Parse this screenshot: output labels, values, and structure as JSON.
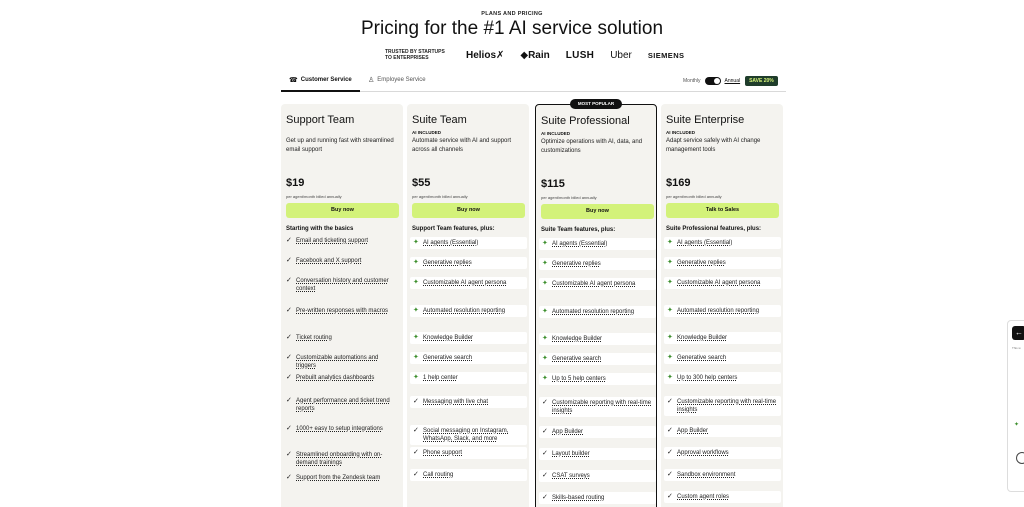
{
  "header": {
    "eyebrow": "PLANS AND PRICING",
    "title": "Pricing for the #1 AI service solution",
    "trusted_line1": "TRUSTED BY STARTUPS",
    "trusted_line2": "TO ENTERPRISES",
    "logos": [
      "Helios✗",
      "◆Rain",
      "LUSH",
      "Uber",
      "SIEMENS"
    ]
  },
  "tabs": [
    {
      "label": "Customer Service",
      "icon": "headset-icon",
      "active": true
    },
    {
      "label": "Employee Service",
      "icon": "people-icon",
      "active": false
    }
  ],
  "billing": {
    "monthly": "Monthly",
    "annual": "Annual",
    "save": "SAVE 20%"
  },
  "popular_badge": "MOST POPULAR",
  "plans": [
    {
      "name": "Support Team",
      "ai": "",
      "desc": "Get up and running fast with streamlined email support",
      "price": "$19",
      "note": "per agent/month billed annually",
      "cta": "Buy now",
      "features_head": "Starting with the basics",
      "features": [
        "Email and ticketing support",
        "Facebook and X support",
        "Conversation history and customer context",
        "Pre-written responses with macros",
        "Ticket routing",
        "Customizable automations and triggers",
        "Prebuilt analytics dashboards",
        "Agent performance and ticket trend reports",
        "1000+ easy to setup integrations",
        "Streamlined onboarding with on-demand trainings",
        "Support from the Zendesk team"
      ]
    },
    {
      "name": "Suite Team",
      "ai": "AI INCLUDED",
      "desc": "Automate service with AI and support across all channels",
      "price": "$55",
      "note": "per agent/month billed annually",
      "cta": "Buy now",
      "features_head": "Support Team features, plus:",
      "features": [
        "AI agents (Essential)",
        "Generative replies",
        "Customizable AI agent persona",
        "Automated resolution reporting",
        "Knowledge Builder",
        "Generative search",
        "1 help center",
        "Messaging with live chat",
        "Social messaging on Instagram, WhatsApp, Slack, and more",
        "Phone support",
        "Call routing"
      ]
    },
    {
      "name": "Suite Professional",
      "ai": "AI INCLUDED",
      "desc": "Optimize operations with AI, data, and customizations",
      "price": "$115",
      "note": "per agent/month billed annually",
      "cta": "Buy now",
      "features_head": "Suite Team features, plus:",
      "features": [
        "AI agents (Essential)",
        "Generative replies",
        "Customizable AI agent persona",
        "Automated resolution reporting",
        "Knowledge Builder",
        "Generative search",
        "Up to 5 help centers",
        "Customizable reporting with real-time insights",
        "App Builder",
        "Layout builder",
        "CSAT surveys",
        "Skills-based routing"
      ]
    },
    {
      "name": "Suite Enterprise",
      "ai": "AI INCLUDED",
      "desc": "Adapt service safely with AI change management tools",
      "price": "$169",
      "note": "per agent/month billed annually",
      "cta": "Talk to Sales",
      "features_head": "Suite Professional features, plus:",
      "features": [
        "AI agents (Essential)",
        "Generative replies",
        "Customizable AI agent persona",
        "Automated resolution reporting",
        "Knowledge Builder",
        "Generative search",
        "Up to 300 help centers",
        "Customizable reporting with real-time insights",
        "App Builder",
        "Approval workflows",
        "Sandbox environment",
        "Custom agent roles"
      ]
    }
  ],
  "side_widget": {
    "back": "←",
    "text": "This w"
  }
}
